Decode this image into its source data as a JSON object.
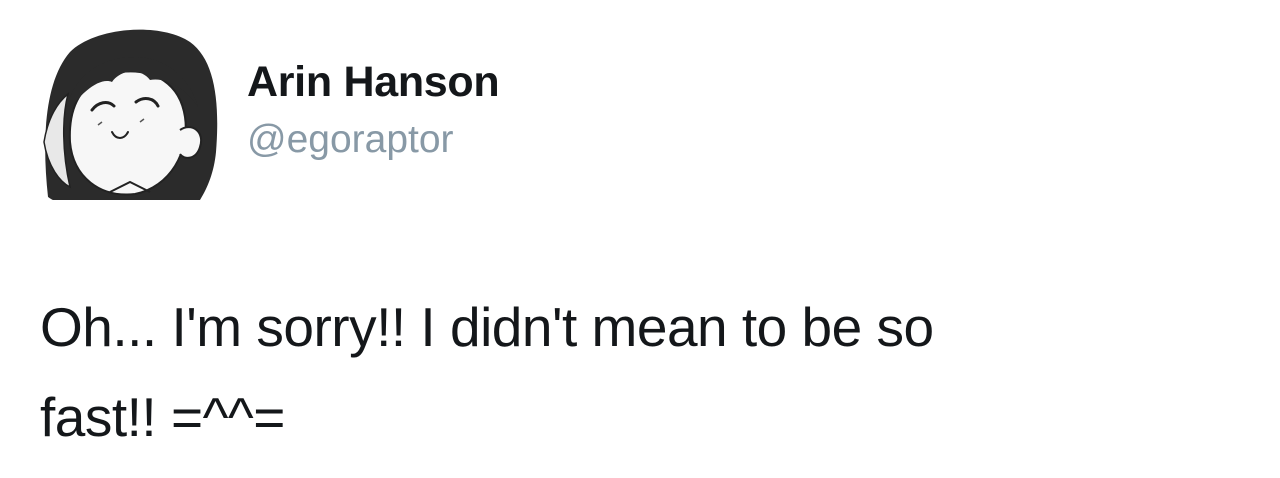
{
  "tweet": {
    "author": {
      "display_name": "Arin Hanson",
      "handle": "@egoraptor",
      "avatar_icon": "cartoon-avatar-icon"
    },
    "text_line_1": "Oh... I'm sorry!! I didn't mean to be so",
    "text_line_2": "fast!! =^^="
  },
  "colors": {
    "text": "#14171a",
    "handle": "#8899a6",
    "background": "#ffffff"
  }
}
